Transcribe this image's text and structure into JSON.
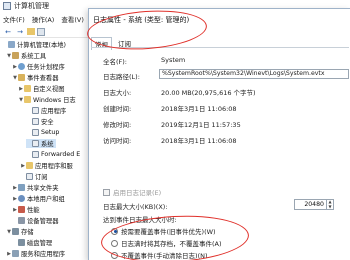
{
  "window": {
    "title": "计算机管理",
    "menu": [
      "文件(F)",
      "操作(A)",
      "查看(V)"
    ]
  },
  "toolbar": {
    "back": "←",
    "forward": "→"
  },
  "tree": [
    {
      "label": "计算机管理(本地)",
      "arrow": "",
      "icon": "ico-comp"
    },
    {
      "label": "系统工具",
      "arrow": "▼",
      "icon": "ico-tool"
    },
    {
      "label": "任务计划程序",
      "arrow": "▶",
      "icon": "ico-clock"
    },
    {
      "label": "事件查看器",
      "arrow": "▼",
      "icon": "ico-event"
    },
    {
      "label": "自定义视图",
      "arrow": "▶",
      "icon": "ico-folder"
    },
    {
      "label": "Windows 日志",
      "arrow": "▼",
      "icon": "ico-folder"
    },
    {
      "label": "应用程序",
      "arrow": "",
      "icon": "ico-log"
    },
    {
      "label": "安全",
      "arrow": "",
      "icon": "ico-log"
    },
    {
      "label": "Setup",
      "arrow": "",
      "icon": "ico-log"
    },
    {
      "label": "系统",
      "arrow": "",
      "icon": "ico-log",
      "selected": true
    },
    {
      "label": "Forwarded E",
      "arrow": "",
      "icon": "ico-log"
    },
    {
      "label": "应用程序和服",
      "arrow": "▶",
      "icon": "ico-folder"
    },
    {
      "label": "订阅",
      "arrow": "",
      "icon": "ico-log"
    },
    {
      "label": "共享文件夹",
      "arrow": "▶",
      "icon": "ico-share"
    },
    {
      "label": "本地用户和组",
      "arrow": "▶",
      "icon": "ico-user"
    },
    {
      "label": "性能",
      "arrow": "▶",
      "icon": "ico-perf"
    },
    {
      "label": "设备管理器",
      "arrow": "",
      "icon": "ico-dev"
    },
    {
      "label": "存储",
      "arrow": "▼",
      "icon": "ico-store"
    },
    {
      "label": "磁盘管理",
      "arrow": "",
      "icon": "ico-store"
    },
    {
      "label": "服务和应用程序",
      "arrow": "▶",
      "icon": "ico-svc"
    }
  ],
  "dialog": {
    "title": "日志属性 - 系统 (类型: 管理的)",
    "tabs": [
      "常规",
      "订阅"
    ],
    "fields": {
      "full_name_label": "全名(F):",
      "full_name_value": "System",
      "log_path_label": "日志路径(L):",
      "log_path_value": "%SystemRoot%\\System32\\Winevt\\Logs\\System.evtx",
      "log_size_label": "日志大小:",
      "log_size_value": "20.00 MB(20,975,616 个字节)",
      "created_label": "创建时间:",
      "created_value": "2018年3月1日 11:06:08",
      "modified_label": "修改时间:",
      "modified_value": "2019年12月1日 11:57:35",
      "accessed_label": "访问时间:",
      "accessed_value": "2018年3月1日 11:06:08"
    },
    "enable_logging_label": "启用日志记录(E)",
    "max_size_label": "日志最大大小(KB)(X):",
    "max_size_value": "20480",
    "spin_up": "▲",
    "spin_down": "▼",
    "policy_label": "达到事件日志最大大小时:",
    "policy_options": [
      {
        "label": "按需要覆盖事件(旧事件优先)(W)",
        "selected": true
      },
      {
        "label": "日志满时将其存档，不覆盖事件(A)",
        "selected": false
      },
      {
        "label": "不覆盖事件(手动清除日志)(N)",
        "selected": false
      }
    ]
  },
  "colors": {
    "annotation": "#e0302a",
    "selection": "#cfe3f7",
    "radio_dot": "#1a4fa0"
  }
}
